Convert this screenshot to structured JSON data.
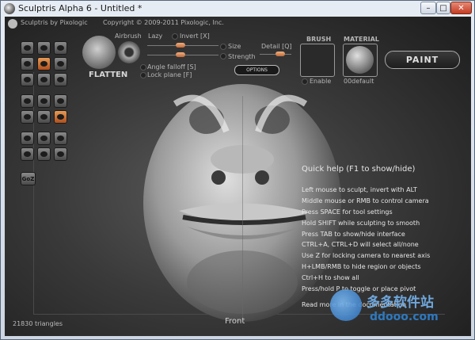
{
  "window": {
    "title": "Sculptris Alpha 6 - Untitled *"
  },
  "window_controls": {
    "minimize": "–",
    "maximize": "□",
    "close": "✕"
  },
  "header": {
    "brand": "Sculptris by Pixologic",
    "copyright": "Copyright © 2009-2011 Pixologic, Inc."
  },
  "tool_settings": {
    "airbrush": "Airbrush",
    "lazy": "Lazy",
    "invert": "Invert [X]",
    "size": "Size",
    "strength": "Strength",
    "detail": "Detail [Q]",
    "angle_falloff": "Angle falloff [S]",
    "lock_plane": "Lock plane [F]",
    "tool_name": "FLATTEN",
    "options": "OPTIONS"
  },
  "brush": {
    "label": "BRUSH",
    "enable": "Enable"
  },
  "material": {
    "label": "MATERIAL",
    "name": "00default"
  },
  "paint_button": "PAINT",
  "goz_button": "GoZ",
  "help": {
    "title": "Quick help (F1 to show/hide)",
    "lines": [
      "Left mouse to sculpt, invert with ALT",
      "Middle mouse or RMB to control camera",
      "Press SPACE for tool settings",
      "Hold SHIFT while sculpting to smooth",
      "Press TAB to show/hide interface",
      "CTRL+A, CTRL+D will select all/none",
      "Use Z for locking camera to nearest axis",
      "H+LMB/RMB to hide region or objects",
      "Ctrl+H to show all",
      "Press/hold P to toggle or place pivot",
      "Read more in the documentation"
    ]
  },
  "viewport": {
    "view_label": "Front",
    "triangles": "21830 triangles"
  },
  "watermark": {
    "title": "多多软件站",
    "url": "ddooo.com"
  }
}
